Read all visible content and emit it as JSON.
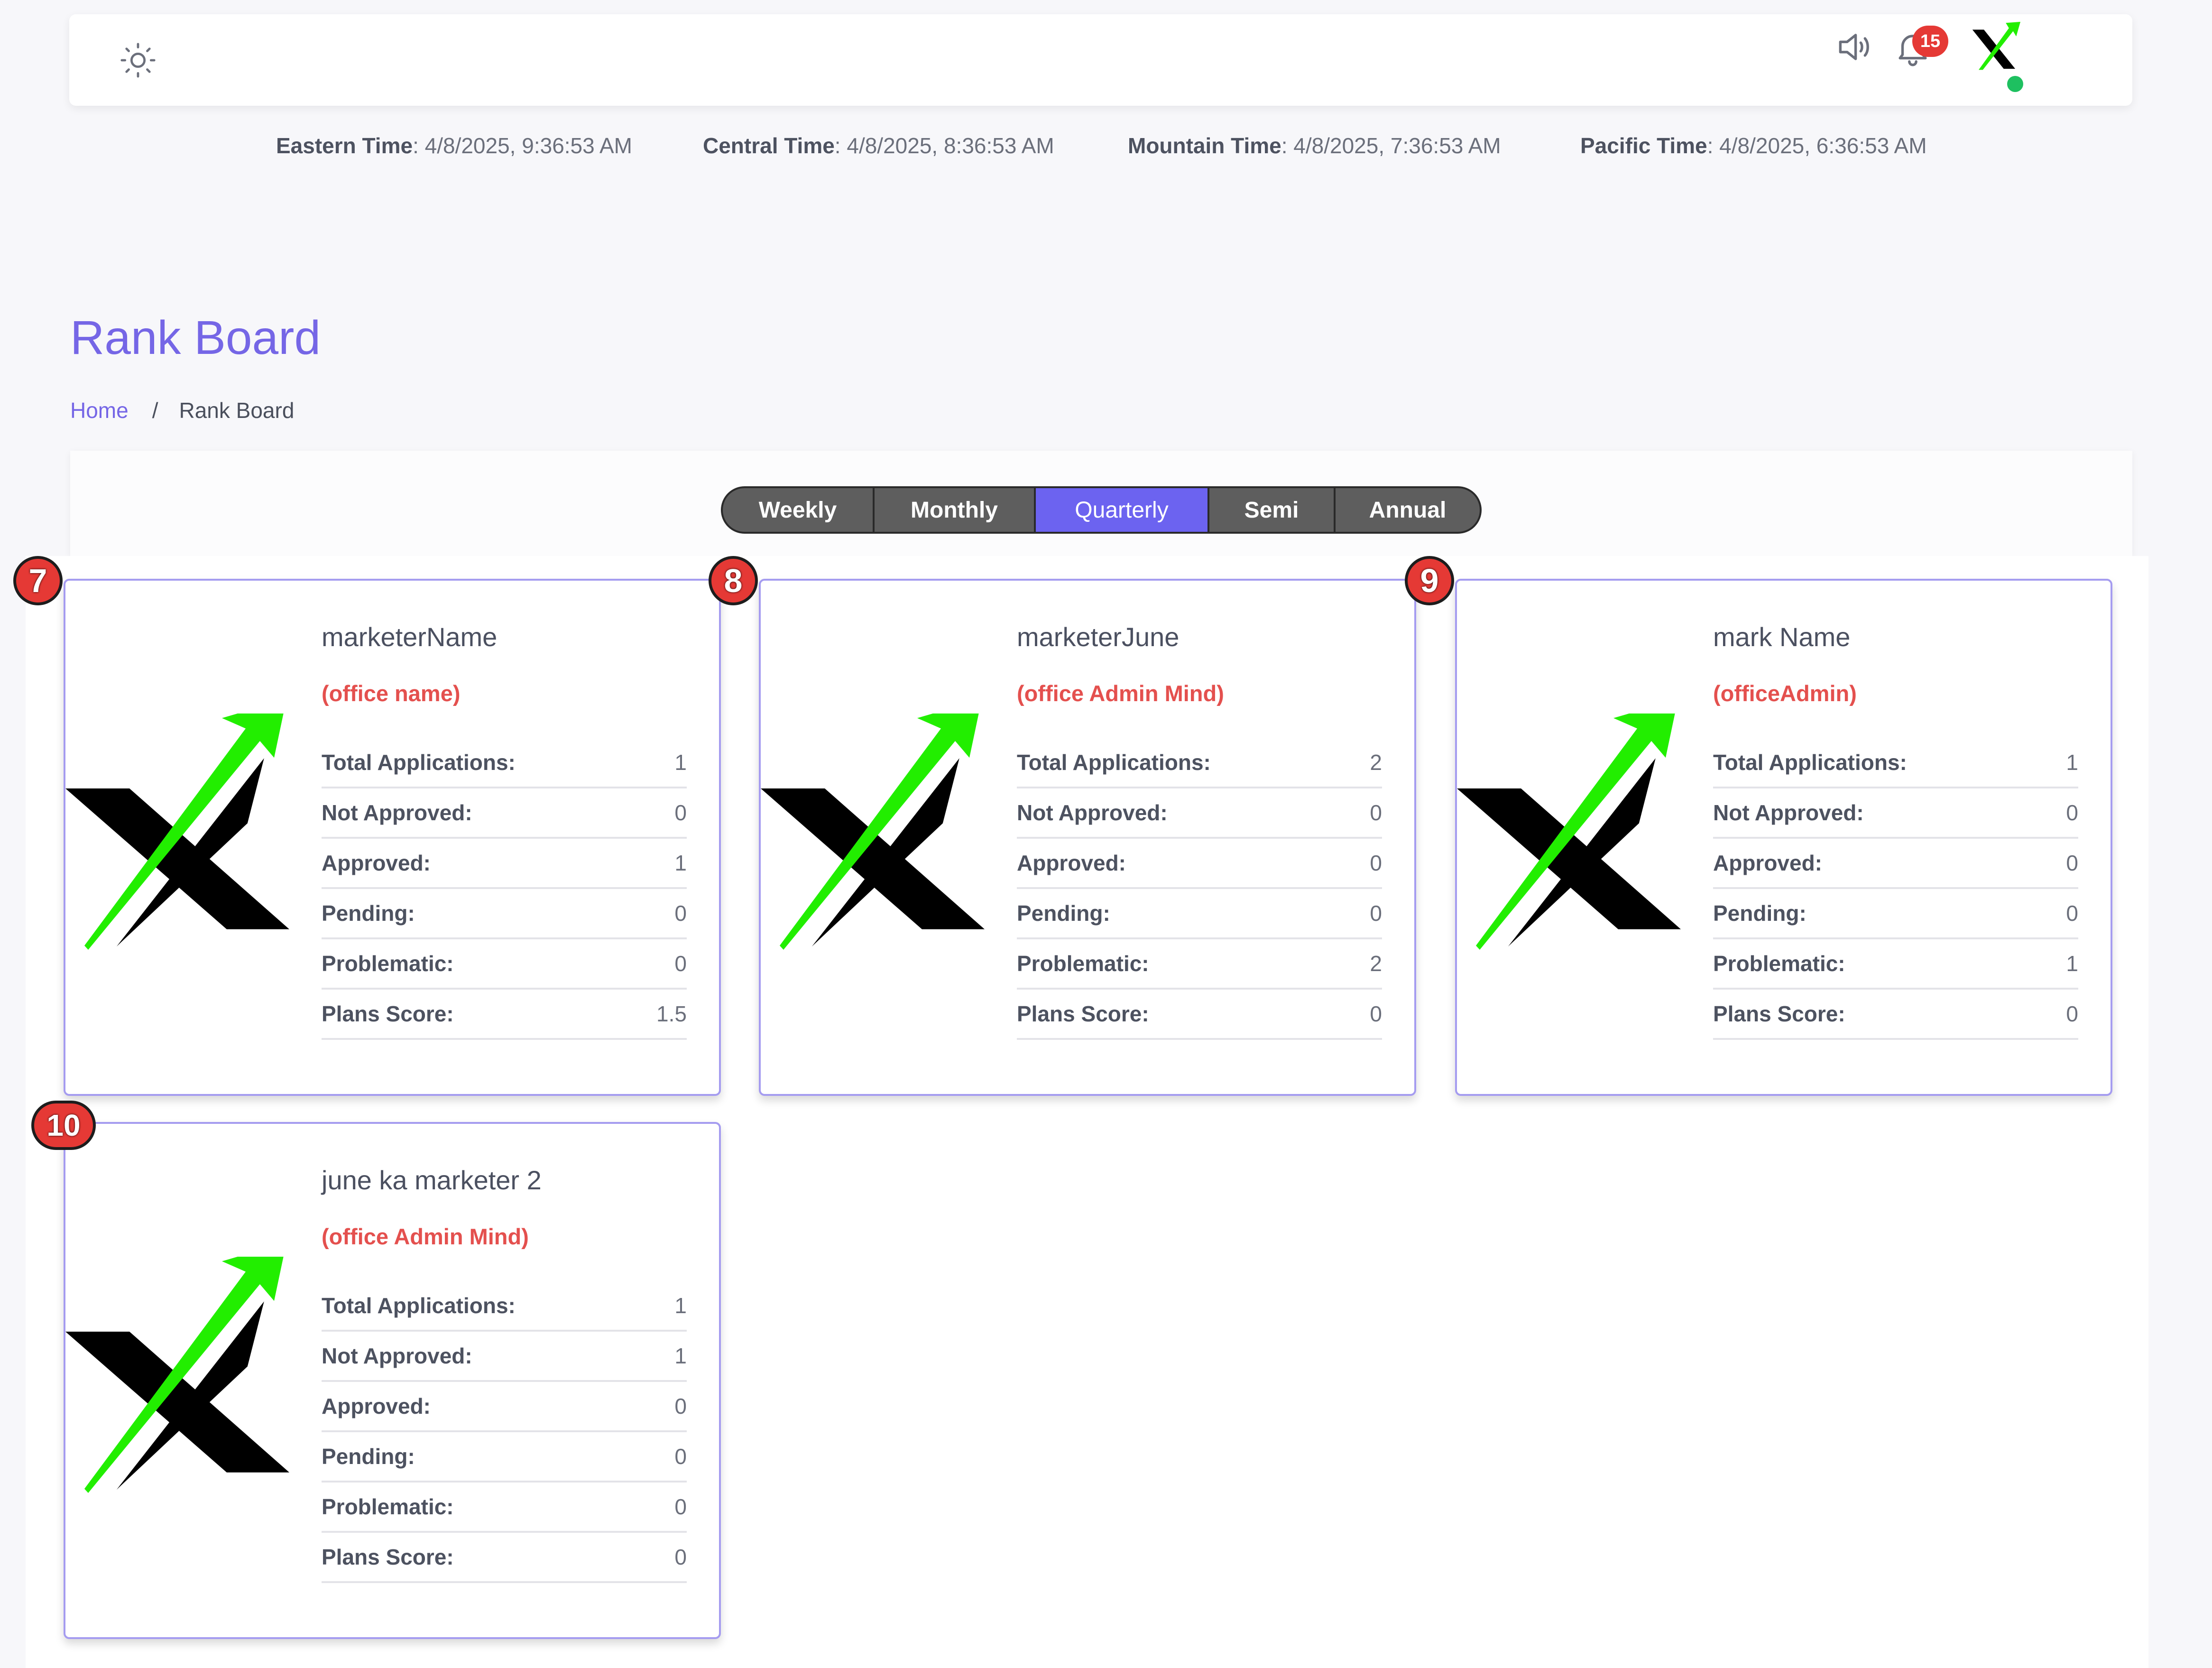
{
  "header": {
    "notification_count": "15",
    "icons": [
      "sun-icon",
      "speaker-icon",
      "bell-icon",
      "brand-logo"
    ]
  },
  "times": [
    {
      "label": "Eastern Time",
      "value": ": 4/8/2025, 9:36:53 AM"
    },
    {
      "label": "Central Time",
      "value": ": 4/8/2025, 8:36:53 AM"
    },
    {
      "label": "Mountain Time",
      "value": ": 4/8/2025, 7:36:53 AM"
    },
    {
      "label": "Pacific Time",
      "value": ": 4/8/2025, 6:36:53 AM"
    }
  ],
  "page": {
    "title": "Rank Board",
    "breadcrumb": {
      "home": "Home",
      "separator": "/",
      "current": "Rank Board"
    }
  },
  "tabs": [
    {
      "label": "Weekly"
    },
    {
      "label": "Monthly"
    },
    {
      "label": "Quarterly",
      "active": true
    },
    {
      "label": "Semi"
    },
    {
      "label": "Annual"
    }
  ],
  "stat_labels": [
    "Total Applications:",
    "Not Approved:",
    "Approved:",
    "Pending:",
    "Problematic:",
    "Plans Score:"
  ],
  "cards": [
    {
      "rank": "7",
      "name": "marketerName",
      "office": "(office name)",
      "stats": [
        "1",
        "0",
        "1",
        "0",
        "0",
        "1.5"
      ]
    },
    {
      "rank": "8",
      "name": "marketerJune",
      "office": "(office Admin Mind)",
      "stats": [
        "2",
        "0",
        "0",
        "0",
        "2",
        "0"
      ]
    },
    {
      "rank": "9",
      "name": "mark Name",
      "office": "(officeAdmin)",
      "stats": [
        "1",
        "0",
        "0",
        "0",
        "1",
        "0"
      ]
    },
    {
      "rank": "10",
      "name": "june ka marketer 2",
      "office": "(office Admin Mind)",
      "stats": [
        "1",
        "1",
        "0",
        "0",
        "0",
        "0"
      ]
    }
  ],
  "colors": {
    "accent": "#7566e6",
    "active_tab": "#6c63f0",
    "office_text": "#e4504e",
    "rank_badge": "#e53935",
    "logo_arrow": "#22ee00",
    "online": "#1ec060"
  }
}
